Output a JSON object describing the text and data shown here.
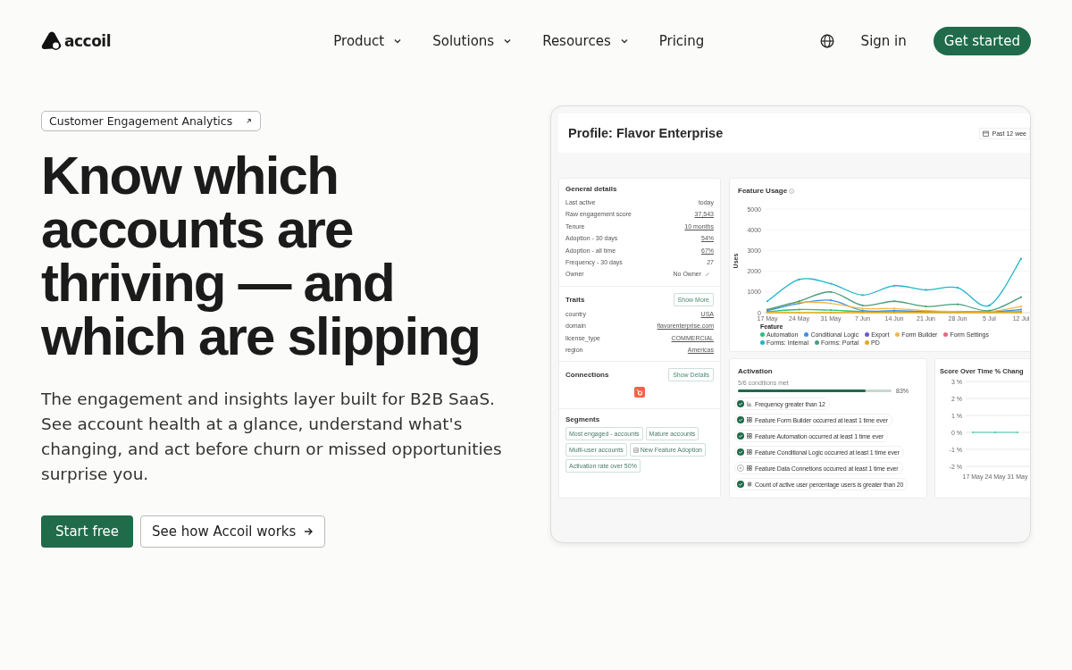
{
  "nav": {
    "brand": "accoil",
    "links": [
      {
        "label": "Product",
        "dropdown": true
      },
      {
        "label": "Solutions",
        "dropdown": true
      },
      {
        "label": "Resources",
        "dropdown": true
      },
      {
        "label": "Pricing",
        "dropdown": false
      }
    ],
    "sign_in": "Sign in",
    "cta": "Get started"
  },
  "hero": {
    "badge": "Customer Engagement Analytics",
    "headline": "Know which accounts are thriving — and which are slipping",
    "text": "The engagement and insights layer built for B2B SaaS. See account health at a glance, understand what's changing, and act before churn or missed opportunities surprise you.",
    "primary": "Start free",
    "secondary": "See how Accoil works"
  },
  "dashboard": {
    "title": "Profile: Flavor Enterprise",
    "range": "Past 12 wee",
    "general": {
      "title": "General details",
      "rows": [
        {
          "label": "Last active",
          "value": "today",
          "kind": "plain"
        },
        {
          "label": "Raw engagement score",
          "value": "37,543",
          "kind": "link"
        },
        {
          "label": "Tenure",
          "value": "10 months",
          "kind": "link"
        },
        {
          "label": "Adoption - 30 days",
          "value": "54%",
          "kind": "link"
        },
        {
          "label": "Adoption - all time",
          "value": "67%",
          "kind": "link"
        },
        {
          "label": "Frequency - 30 days",
          "value": "27",
          "kind": "plain"
        },
        {
          "label": "Owner",
          "value": "No Owner",
          "kind": "editable"
        }
      ]
    },
    "traits": {
      "title": "Traits",
      "button": "Show More",
      "rows": [
        {
          "label": "country",
          "value": "USA"
        },
        {
          "label": "domain",
          "value": "flavorenterprise.com"
        },
        {
          "label": "license_type",
          "value": "COMMERCIAL"
        },
        {
          "label": "region",
          "value": "Americas"
        }
      ]
    },
    "connections": {
      "title": "Connections",
      "button": "Show Details"
    },
    "segments": {
      "title": "Segments",
      "items": [
        {
          "label": "Most engaged - accounts",
          "kind": "plain"
        },
        {
          "label": "Mature accounts",
          "kind": "plain"
        },
        {
          "label": "Multi-user accounts",
          "kind": "plain"
        },
        {
          "label": "New Feature Adoption",
          "kind": "report"
        },
        {
          "label": "Activation rate over 50%",
          "kind": "plain"
        }
      ]
    },
    "feature_usage": {
      "title": "Feature Usage",
      "legend_title": "Feature",
      "chart_data": {
        "type": "line",
        "ylabel": "Uses",
        "grid": true,
        "categories": [
          "17 May",
          "24 May",
          "31 May",
          "7 Jun",
          "14 Jun",
          "21 Jun",
          "28 Jun",
          "5 Jul",
          "12 Jul"
        ],
        "yticks": [
          0,
          1000,
          2000,
          3000,
          4000,
          5000
        ],
        "ylim": [
          0,
          5000
        ],
        "series": [
          {
            "name": "Automation",
            "color": "#2bbf7a",
            "values": [
              50,
              150,
              120,
              50,
              50,
              50,
              50,
              50,
              50
            ]
          },
          {
            "name": "Conditional Logic",
            "color": "#3b8ee8",
            "values": [
              100,
              450,
              600,
              100,
              100,
              50,
              50,
              50,
              150
            ]
          },
          {
            "name": "Export",
            "color": "#6a5acd",
            "values": [
              null,
              null,
              null,
              null,
              null,
              null,
              null,
              null,
              null
            ]
          },
          {
            "name": "Form Builder",
            "color": "#f2b84b",
            "values": [
              150,
              500,
              450,
              200,
              200,
              100,
              50,
              50,
              300
            ]
          },
          {
            "name": "Form Settings",
            "color": "#e8677a",
            "values": [
              null,
              null,
              null,
              null,
              null,
              null,
              null,
              null,
              null
            ]
          },
          {
            "name": "Forms: Internal",
            "color": "#1fb5c9",
            "values": [
              550,
              1600,
              1400,
              850,
              1300,
              1100,
              1200,
              350,
              2600
            ]
          },
          {
            "name": "Forms: Portal",
            "color": "#4a9e7a",
            "values": [
              150,
              550,
              1000,
              350,
              550,
              300,
              400,
              100,
              750
            ]
          },
          {
            "name": "PD",
            "color": "#e5a91a",
            "values": [
              0,
              0,
              0,
              0,
              0,
              0,
              0,
              0,
              0
            ]
          }
        ]
      }
    },
    "activation": {
      "title": "Activation",
      "subtitle": "5/6 conditions met",
      "level": 0.83,
      "percent": "83%",
      "conditions": [
        {
          "label": "Frequency greater than 12",
          "kind": "chart",
          "met": true
        },
        {
          "label": "Feature Form Builder occurred at least 1 time ever",
          "kind": "feature",
          "met": true
        },
        {
          "label": "Feature Automation occurred at least 1 time ever",
          "kind": "feature",
          "met": true
        },
        {
          "label": "Feature Conditional Logic occurred at least 1 time ever",
          "kind": "feature",
          "met": true
        },
        {
          "label": "Feature Data Connetions occurred at least 1 time ever",
          "kind": "feature",
          "met": false
        },
        {
          "label": "Count of active user percentage users is greater than 20",
          "kind": "count",
          "met": true
        }
      ]
    },
    "score": {
      "title": "Score Over Time % Chang",
      "chart_data": {
        "type": "line",
        "grid": true,
        "categories": [
          "17 May",
          "24 May",
          "31 May"
        ],
        "yticks": [
          {
            "value": 3,
            "label": "3 %"
          },
          {
            "value": 2,
            "label": "2 %"
          },
          {
            "value": 1,
            "label": "1 %"
          },
          {
            "value": 0,
            "label": "0 %"
          },
          {
            "value": -1,
            "label": "-1 %"
          },
          {
            "value": -2,
            "label": "-2 %"
          }
        ],
        "ylim": [
          -2,
          3
        ],
        "series": [
          {
            "color": "#3ec9a7",
            "values": [
              0,
              0,
              0
            ]
          }
        ]
      }
    }
  }
}
